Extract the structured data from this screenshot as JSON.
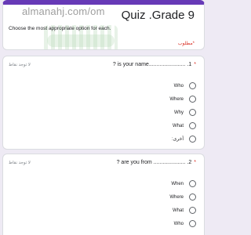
{
  "watermark": {
    "url": "almanahj.com/om"
  },
  "form": {
    "title": "Quiz .Grade 9",
    "description": "Choose the most appropriate option for each.",
    "required_note": "*مطلوب"
  },
  "questions": [
    {
      "title": "1. ........................is your name ?",
      "required_marker": "*",
      "points": "لا توجد نقاط",
      "options": [
        "Who",
        "Where",
        "Why",
        "What",
        "أخرى:"
      ]
    },
    {
      "title": "2. ..................... are you from ?",
      "required_marker": "*",
      "points": "لا توجد نقاط",
      "options": [
        "When",
        "Where",
        "What",
        "Who"
      ]
    }
  ],
  "colors": {
    "accent": "#673ab7",
    "background": "#eeeaf4",
    "required": "#d93025"
  }
}
